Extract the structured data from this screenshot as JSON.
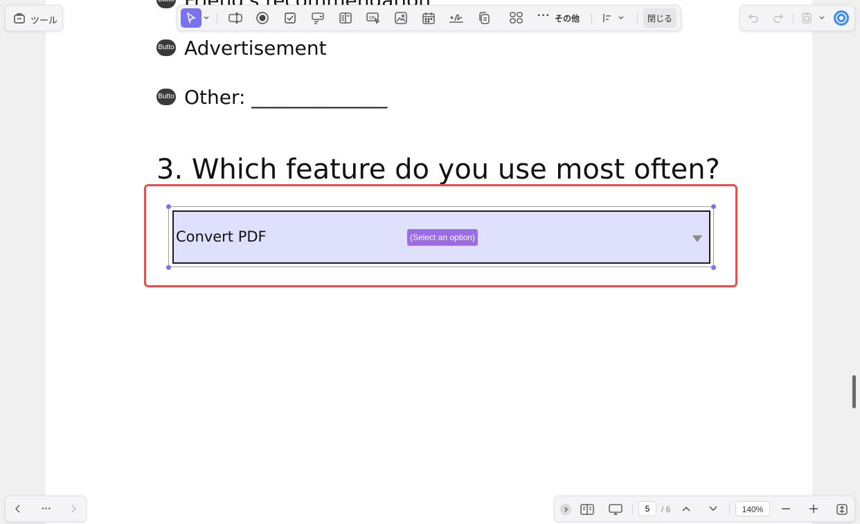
{
  "tools_button": {
    "label": "ツール",
    "icon": "tools-icon"
  },
  "document": {
    "partial_option_label": "Friend's recommendation",
    "radio_button_text": "Butto",
    "options": [
      {
        "label": "Advertisement"
      },
      {
        "label": "Other: ______________"
      }
    ],
    "question": "3. Which feature do you use most often?",
    "dropdown_field": {
      "value": "Convert PDF",
      "placeholder": "(Select an option)"
    }
  },
  "toolbar": {
    "more_label": "その他",
    "close_label": "閉じる",
    "items": [
      {
        "name": "select-tool",
        "icon": "cursor-icon",
        "active": true
      },
      {
        "name": "text-field-tool",
        "icon": "text-field-icon"
      },
      {
        "name": "radio-button-tool",
        "icon": "radio-icon"
      },
      {
        "name": "checkbox-tool",
        "icon": "checkbox-icon"
      },
      {
        "name": "combo-box-tool",
        "icon": "combo-box-icon"
      },
      {
        "name": "list-box-tool",
        "icon": "list-box-icon"
      },
      {
        "name": "button-tool",
        "icon": "ok-button-icon"
      },
      {
        "name": "image-field-tool",
        "icon": "image-field-icon"
      },
      {
        "name": "date-field-tool",
        "icon": "calendar-icon"
      },
      {
        "name": "signature-tool",
        "icon": "signature-icon"
      },
      {
        "name": "copy-tool",
        "icon": "copy-icon"
      },
      {
        "name": "grid-tool",
        "icon": "grid-icon"
      }
    ]
  },
  "right_panel": {
    "undo_icon": "undo-icon",
    "redo_icon": "redo-icon",
    "save_icon": "save-icon",
    "ai_icon": "ai-assistant-icon"
  },
  "bottom_left": {
    "more_label": "···"
  },
  "bottom_right": {
    "current_page": "5",
    "total_pages": "/ 6",
    "zoom": "140%"
  },
  "colors": {
    "accent": "#7b6ef6",
    "highlight_border": "#e05252",
    "field_background": "#dfe1fc",
    "placeholder_badge": "#9b6ce6"
  }
}
